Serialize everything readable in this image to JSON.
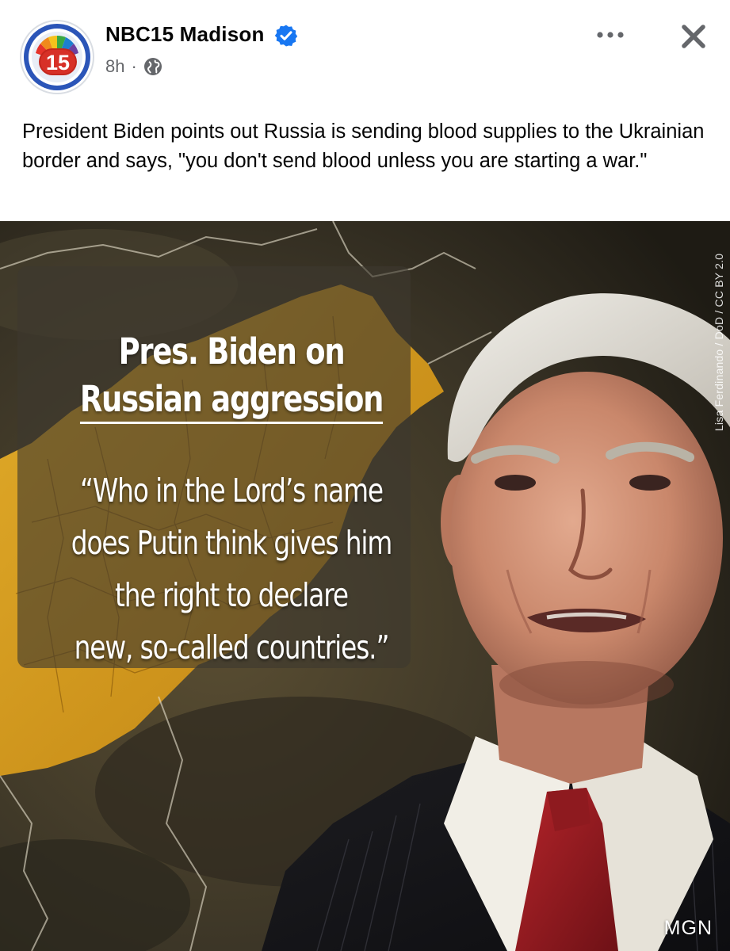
{
  "post": {
    "author": "NBC15 Madison",
    "verified": true,
    "time": "8h",
    "separator": "·",
    "audience_icon": "globe-icon",
    "caption": "President Biden points out Russia is sending blood supplies to the Ukrainian border and says, \"you don't send blood unless you are starting a war.\"",
    "avatar_badge": "15"
  },
  "header": {
    "more_icon": "more-icon",
    "close_icon": "close-icon"
  },
  "image": {
    "title_line1": "Pres. Biden on",
    "title_line2": "Russian aggression",
    "quote_lines": [
      "“Who in the Lord’s name",
      "does Putin think gives him",
      "the right to declare",
      "new, so-called countries.”"
    ],
    "credit": "Lisa Ferdinando / DoD / CC BY 2.0",
    "watermark": "MGN"
  },
  "colors": {
    "verified_blue": "#1877f2",
    "meta_gray": "#65676b",
    "map_gold": "#e0a21c",
    "avatar_ring": "#2b55b8"
  }
}
